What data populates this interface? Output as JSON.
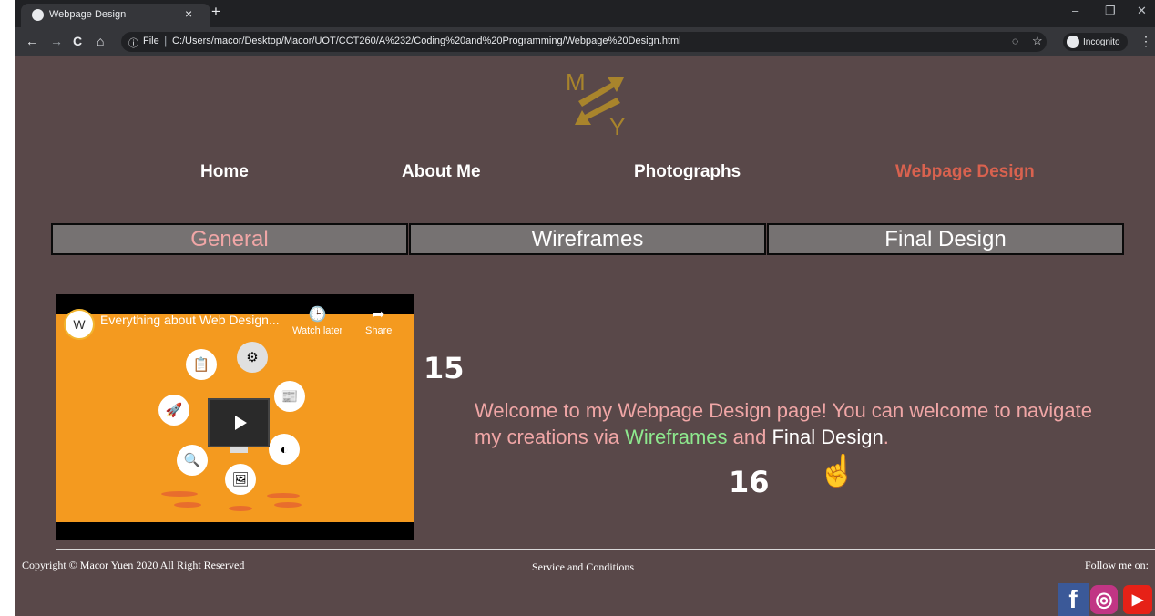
{
  "browser": {
    "tab_title": "Webpage Design",
    "tab_close": "×",
    "new_tab": "+",
    "window_controls": [
      "–",
      "❐",
      "✕"
    ],
    "nav_buttons": [
      "←",
      "→",
      "C",
      "⌂"
    ],
    "address_label": "File",
    "address_separator": "|",
    "url": "C:/Users/macor/Desktop/Macor/UOT/CCT260/A%232/Coding%20and%20Programming/Webpage%20Design.html",
    "incognito_label": "Incognito",
    "menu_glyph": "⋮",
    "eye_icon_glyph": "◌",
    "star_glyph": "☆",
    "info_glyph": "ⓘ"
  },
  "logo": {
    "letters": [
      "M",
      "Y"
    ],
    "color": "#a8842c"
  },
  "nav": [
    {
      "label": "Home",
      "active": false
    },
    {
      "label": "About Me",
      "active": false
    },
    {
      "label": "Photographs",
      "active": false
    },
    {
      "label": "Webpage Design",
      "active": true
    }
  ],
  "subtabs": [
    {
      "label": "General",
      "active": true
    },
    {
      "label": "Wireframes",
      "active": false
    },
    {
      "label": "Final Design",
      "active": false
    }
  ],
  "video": {
    "title": "Everything about Web Design...",
    "channel_initial": "W",
    "watch_later": "Watch later",
    "share": "Share",
    "clock_glyph": "🕒",
    "share_glyph": "➦",
    "icons": [
      "📋",
      "⚙",
      "🚀",
      "📰",
      "🔍",
      "◐",
      "🖼"
    ]
  },
  "annotations": {
    "step15": "15",
    "step16": "16"
  },
  "welcome": {
    "part1": "Welcome to my Webpage Design page! You can welcome to navigate my creations via ",
    "link1": "Wireframes",
    "part2": " and ",
    "link2": "Final Design",
    "part3": "."
  },
  "cursor_glyph": "☝",
  "footer": {
    "copyright": "Copyright © Macor Yuen 2020 All Right Reserved",
    "service": "Service and Conditions",
    "follow": "Follow me on:",
    "social": [
      {
        "name": "facebook",
        "glyph": "f",
        "color": "#3b5998"
      },
      {
        "name": "instagram",
        "glyph": "◎",
        "color": "#c13584"
      },
      {
        "name": "youtube",
        "glyph": "▶",
        "color": "#e62117"
      }
    ]
  },
  "colors": {
    "page_bg": "#594849",
    "nav_active": "#d9624f",
    "tab_active_text": "#f0a6a6",
    "tab_bg": "#767272",
    "welcome_text": "#f0a6a6",
    "link_wireframes": "#8ee88e",
    "link_final": "#ffffff",
    "video_bg": "#f49a1f"
  }
}
